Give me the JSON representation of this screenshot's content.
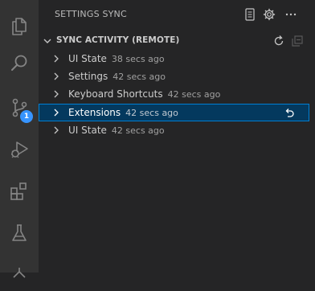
{
  "activity_bar": {
    "items": [
      {
        "icon": "files-icon"
      },
      {
        "icon": "search-icon"
      },
      {
        "icon": "source-control-icon",
        "badge": "1"
      },
      {
        "icon": "run-debug-icon"
      },
      {
        "icon": "extensions-icon"
      },
      {
        "icon": "testing-icon"
      },
      {
        "icon": "remote-icon"
      }
    ]
  },
  "sidebar": {
    "title": "SETTINGS SYNC",
    "header_actions": [
      "show-log-icon",
      "settings-gear-icon",
      "more-actions-icon"
    ]
  },
  "section": {
    "title": "SYNC ACTIVITY (REMOTE)",
    "actions": [
      "refresh-icon",
      "collapse-all-icon"
    ],
    "items": [
      {
        "label": "UI State",
        "description": "38 secs ago",
        "selected": false
      },
      {
        "label": "Settings",
        "description": "42 secs ago",
        "selected": false
      },
      {
        "label": "Keyboard Shortcuts",
        "description": "42 secs ago",
        "selected": false
      },
      {
        "label": "Extensions",
        "description": "42 secs ago",
        "selected": true,
        "action": "restore-icon"
      },
      {
        "label": "UI State",
        "description": "42 secs ago",
        "selected": false
      }
    ]
  },
  "colors": {
    "activity_bar_bg": "#333333",
    "sidebar_bg": "#252526",
    "selection_bg": "#04395e",
    "selection_border": "#007fd4",
    "badge_bg": "#3794ff"
  }
}
